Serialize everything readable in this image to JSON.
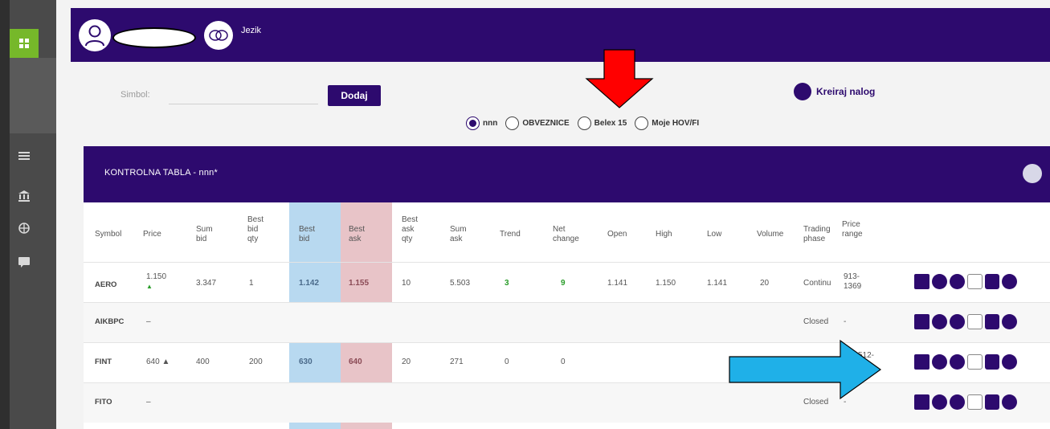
{
  "colors": {
    "brand": "#2d0a6e",
    "accent_green": "#76b82a",
    "bid_column": "#b8d9f0",
    "ask_column": "#e8c4c8",
    "annotation_red": "#ff0000",
    "annotation_blue": "#1fb0e8"
  },
  "header": {
    "language_label": "Jezik"
  },
  "search": {
    "label": "Simbol:",
    "value": "",
    "button_label": "Dodaj"
  },
  "create_order": {
    "label": "Kreiraj nalog"
  },
  "radio_group": {
    "options": [
      {
        "label": "nnn",
        "selected": true
      },
      {
        "label": "OBVEZNICE",
        "selected": false
      },
      {
        "label": "Belex 15",
        "selected": false
      },
      {
        "label": "Moje HOV/FI",
        "selected": false
      }
    ]
  },
  "panel": {
    "title": "KONTROLNA TABLA - nnn*"
  },
  "table": {
    "columns": [
      [
        "Symbol"
      ],
      [
        "Price"
      ],
      [
        "Sum",
        "bid"
      ],
      [
        "Best",
        "bid",
        "qty"
      ],
      [
        "Best",
        "bid"
      ],
      [
        "Best",
        "ask"
      ],
      [
        "Best",
        "ask",
        "qty"
      ],
      [
        "Sum",
        "ask"
      ],
      [
        "Trend"
      ],
      [
        "Net",
        "change"
      ],
      [
        "Open"
      ],
      [
        "High"
      ],
      [
        "Low"
      ],
      [
        "Volume"
      ],
      [
        "Trading",
        "phase"
      ],
      [
        "Price",
        "range"
      ]
    ],
    "rows": [
      {
        "symbol": "AERO",
        "price": "1.150",
        "price_arrow": "▲",
        "sum_bid": "3.347",
        "best_bid_qty": "1",
        "best_bid": "1.142",
        "best_ask": "1.155",
        "best_ask_qty": "10",
        "sum_ask": "5.503",
        "trend": "3",
        "net_change": "9",
        "open": "1.141",
        "high": "1.150",
        "low": "1.141",
        "volume": "20",
        "trading_phase": "Continu",
        "price_range_1": "913-",
        "price_range_2": "1369"
      },
      {
        "symbol": "AIKBPC",
        "price": "–",
        "price_arrow": "",
        "sum_bid": "",
        "best_bid_qty": "",
        "best_bid": "",
        "best_ask": "",
        "best_ask_qty": "",
        "sum_ask": "",
        "trend": "",
        "net_change": "",
        "open": "",
        "high": "",
        "low": "",
        "volume": "",
        "trading_phase": "Closed",
        "price_range_1": "-",
        "price_range_2": ""
      },
      {
        "symbol": "FINT",
        "price": "640 ▲",
        "price_arrow": "",
        "sum_bid": "400",
        "best_bid_qty": "200",
        "best_bid": "630",
        "best_ask": "640",
        "best_ask_qty": "20",
        "sum_ask": "271",
        "trend": "0",
        "net_change": "0",
        "open": "",
        "high": "",
        "low": "",
        "volume": "",
        "trading_phase": "",
        "price_range_1": "512-",
        "price_range_2": "8"
      },
      {
        "symbol": "FITO",
        "price": "–",
        "price_arrow": "",
        "sum_bid": "",
        "best_bid_qty": "",
        "best_bid": "",
        "best_ask": "",
        "best_ask_qty": "",
        "sum_ask": "",
        "trend": "",
        "net_change": "",
        "open": "",
        "high": "",
        "low": "",
        "volume": "",
        "trading_phase": "Closed",
        "price_range_1": "-",
        "price_range_2": ""
      }
    ],
    "row_action_icons": [
      "calendar-grid-icon",
      "circle-action-icon",
      "circle-cancel-icon",
      "document-icon",
      "bag-icon",
      "circle-go-icon"
    ]
  },
  "sidebar": {
    "icons": [
      "dashboard-icon",
      "list-icon",
      "bank-icon",
      "globe-icon",
      "chat-icon"
    ]
  }
}
